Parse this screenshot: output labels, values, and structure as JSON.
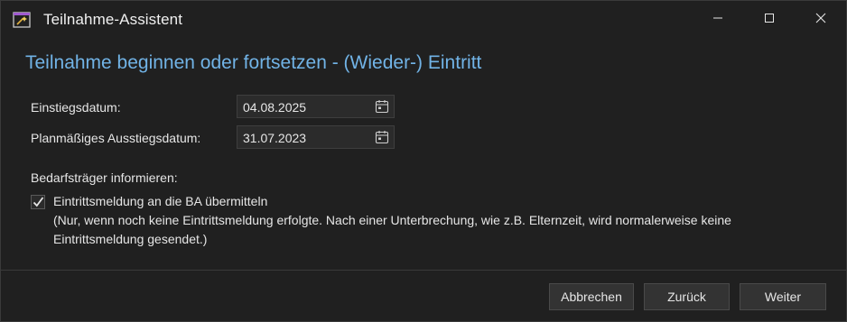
{
  "window": {
    "title": "Teilnahme-Assistent"
  },
  "icons": {
    "app": "wand-window-icon",
    "minimize": "minimize-icon",
    "maximize": "maximize-icon",
    "close": "close-icon",
    "calendar": "calendar-icon",
    "check": "checkmark-icon"
  },
  "colors": {
    "heading": "#71b3e6",
    "background": "#202020",
    "input_bg": "#2b2b2b"
  },
  "main": {
    "heading": "Teilnahme beginnen oder fortsetzen - (Wieder-) Eintritt",
    "fields": [
      {
        "label": "Einstiegsdatum:",
        "value": "04.08.2025"
      },
      {
        "label": "Planmäßiges Ausstiegsdatum:",
        "value": "31.07.2023"
      }
    ],
    "section_label": "Bedarfsträger informieren:",
    "checkbox": {
      "checked": true,
      "label": "Eintrittsmeldung an die BA übermitteln",
      "note_line1": "(Nur, wenn noch keine Eintrittsmeldung erfolgte. Nach einer Unterbrechung, wie z.B. Elternzeit, wird normalerweise keine",
      "note_line2": "Eintrittsmeldung gesendet.)"
    }
  },
  "footer": {
    "cancel_label": "Abbrechen",
    "back_label": "Zurück",
    "next_label": "Weiter"
  }
}
